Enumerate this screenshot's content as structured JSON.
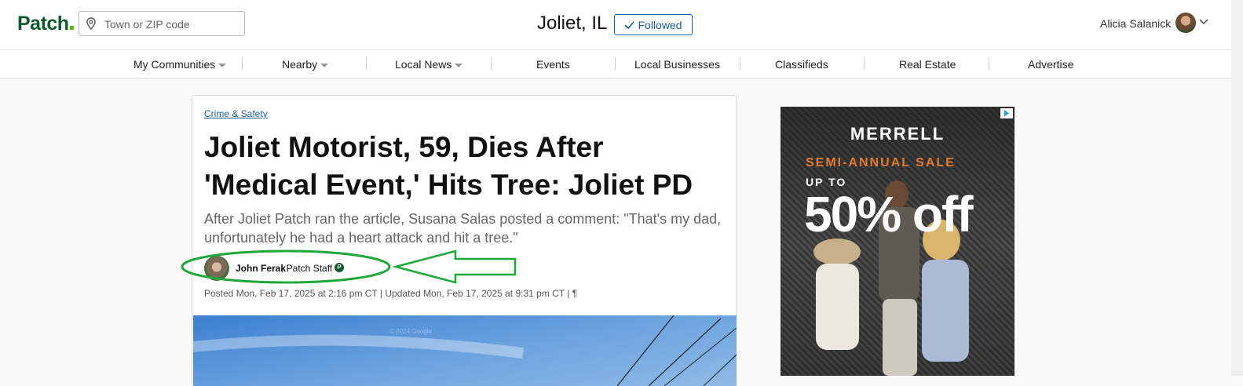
{
  "header": {
    "logo": "Patch",
    "search_placeholder": "Town or ZIP code",
    "city": "Joliet, IL",
    "follow_label": "Followed",
    "user_name": "Alicia Salanick"
  },
  "nav": {
    "items": [
      {
        "label": "My Communities",
        "dropdown": true
      },
      {
        "label": "Nearby",
        "dropdown": true
      },
      {
        "label": "Local News",
        "dropdown": true
      },
      {
        "label": "Events",
        "dropdown": false
      },
      {
        "label": "Local Businesses",
        "dropdown": false
      },
      {
        "label": "Classifieds",
        "dropdown": false
      },
      {
        "label": "Real Estate",
        "dropdown": false
      },
      {
        "label": "Advertise",
        "dropdown": false
      }
    ]
  },
  "article": {
    "category": "Crime & Safety",
    "headline": "Joliet Motorist, 59, Dies After 'Medical Event,' Hits Tree: Joliet PD",
    "dek": "After Joliet Patch ran the article, Susana Salas posted a comment: \"That's my dad, unfortunately he had a heart attack and hit a tree.\"",
    "author_name": "John Ferak",
    "author_role": ", Patch Staff",
    "badge": "P",
    "posted": "Posted Mon, Feb 17, 2025 at 2:16 pm CT  |  Updated Mon, Feb 17, 2025 at 9:31 pm CT  |  ¶",
    "image_watermark": "© 2024 Google"
  },
  "ad": {
    "brand": "MERRELL",
    "sale": "SEMI-ANNUAL SALE",
    "up_to": "UP TO",
    "percent": "50% off"
  },
  "colors": {
    "brand_green": "#0e5a2e",
    "link_blue": "#1a5e9e",
    "annotation_green": "#1fa83a",
    "ad_orange": "#e37a30"
  },
  "icons": [
    "location-pin-icon",
    "checkmark-icon",
    "chevron-down-icon",
    "ad-choices-icon"
  ]
}
